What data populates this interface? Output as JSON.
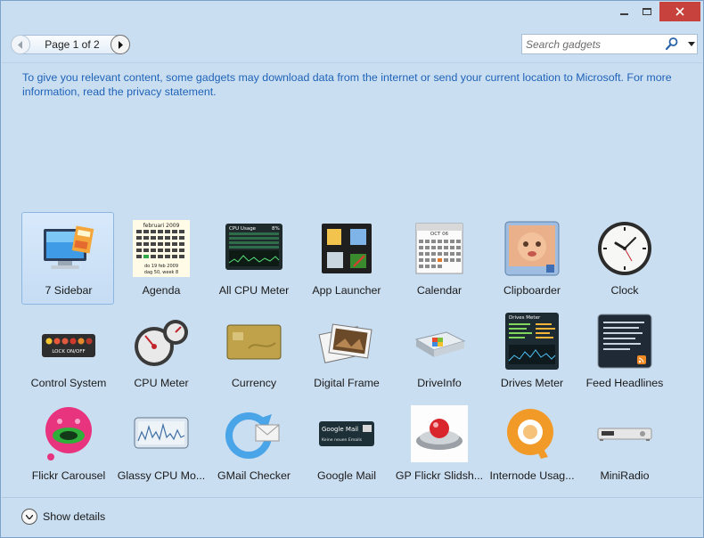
{
  "window": {
    "controls": {
      "minimize": "minimize-icon",
      "maximize": "maximize-icon",
      "close": "close-icon"
    }
  },
  "toolbar": {
    "page_label": "Page 1 of 2",
    "prev_icon": "chevron-left-icon",
    "next_icon": "chevron-right-icon"
  },
  "search": {
    "placeholder": "Search gadgets",
    "value": "",
    "icon": "search-icon",
    "dropdown_icon": "dropdown-arrow-icon"
  },
  "notice": {
    "text": "To give you relevant content, some gadgets may download data from the internet or send your current location to Microsoft. For more information, read the privacy statement."
  },
  "gadgets": [
    {
      "label": "7 Sidebar",
      "icon": "monitor-sidebar-icon",
      "selected": true
    },
    {
      "label": "Agenda",
      "icon": "agenda-calendar-icon"
    },
    {
      "label": "All CPU Meter",
      "icon": "cpu-usage-icon"
    },
    {
      "label": "App Launcher",
      "icon": "app-launcher-icon"
    },
    {
      "label": "Calendar",
      "icon": "calendar-icon"
    },
    {
      "label": "Clipboarder",
      "icon": "clipboarder-icon"
    },
    {
      "label": "Clock",
      "icon": "clock-icon"
    },
    {
      "label": "Control System",
      "icon": "control-system-icon"
    },
    {
      "label": "CPU Meter",
      "icon": "cpu-meter-gauge-icon"
    },
    {
      "label": "Currency",
      "icon": "currency-card-icon"
    },
    {
      "label": "Digital Frame",
      "icon": "photo-frame-icon"
    },
    {
      "label": "DriveInfo",
      "icon": "hard-drive-icon"
    },
    {
      "label": "Drives Meter",
      "icon": "drives-meter-icon"
    },
    {
      "label": "Feed Headlines",
      "icon": "feed-headlines-icon"
    },
    {
      "label": "Flickr Carousel",
      "icon": "flickr-carousel-icon"
    },
    {
      "label": "Glassy CPU Mo...",
      "icon": "glassy-cpu-icon"
    },
    {
      "label": "GMail Checker",
      "icon": "gmail-checker-icon"
    },
    {
      "label": "Google Mail",
      "icon": "google-mail-icon"
    },
    {
      "label": "GP Flickr Slidsh...",
      "icon": "flickr-slideshow-icon"
    },
    {
      "label": "Internode Usag...",
      "icon": "internode-usage-icon"
    },
    {
      "label": "MiniRadio",
      "icon": "mini-radio-icon"
    }
  ],
  "agenda_thumb": {
    "month": "februari 2009",
    "foot1": "do 19 feb 2009",
    "foot2": "dag 50, week 8"
  },
  "cpu_thumb": {
    "title": "CPU Usage",
    "value": "8%"
  },
  "calendar_thumb": {
    "month": "OCT 06"
  },
  "control_thumb": {
    "text": "LOCK ON/OFF"
  },
  "drives_thumb": {
    "title": "Drives Meter"
  },
  "googlemail_thumb": {
    "title": "Google Mail",
    "sub": "Keine neuen Emails"
  },
  "footer": {
    "details_label": "Show details",
    "details_icon": "chevron-down-icon"
  }
}
